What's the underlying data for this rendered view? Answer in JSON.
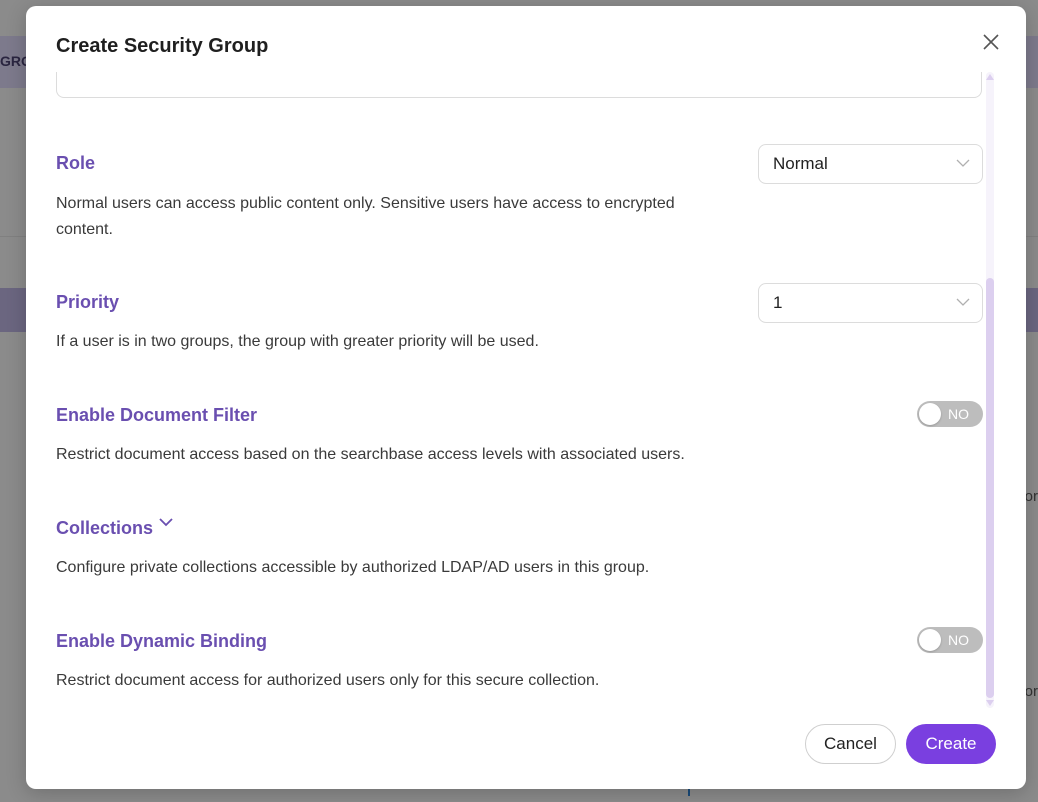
{
  "background": {
    "band_text": "GRO",
    "fragments": [
      "or",
      "or"
    ]
  },
  "modal": {
    "title": "Create Security Group",
    "close_icon": "close-icon"
  },
  "sections": {
    "role": {
      "title": "Role",
      "description": "Normal users can access public content only. Sensitive users have access to encrypted content.",
      "selected": "Normal"
    },
    "priority": {
      "title": "Priority",
      "description": "If a user is in two groups, the group with greater priority will be used.",
      "selected": "1"
    },
    "document_filter": {
      "title": "Enable Document Filter",
      "description": "Restrict document access based on the searchbase access levels with associated users.",
      "toggle_label": "NO",
      "enabled": false
    },
    "collections": {
      "title": "Collections",
      "description": "Configure private collections accessible by authorized LDAP/AD users in this group."
    },
    "dynamic_binding": {
      "title": "Enable Dynamic Binding",
      "description": "Restrict document access for authorized users only for this secure collection.",
      "toggle_label": "NO",
      "enabled": false
    }
  },
  "footer": {
    "cancel_label": "Cancel",
    "create_label": "Create"
  },
  "colors": {
    "accent": "#7a3fe0",
    "section_title": "#6a4fb0",
    "toggle_off": "#bdbdbd"
  }
}
